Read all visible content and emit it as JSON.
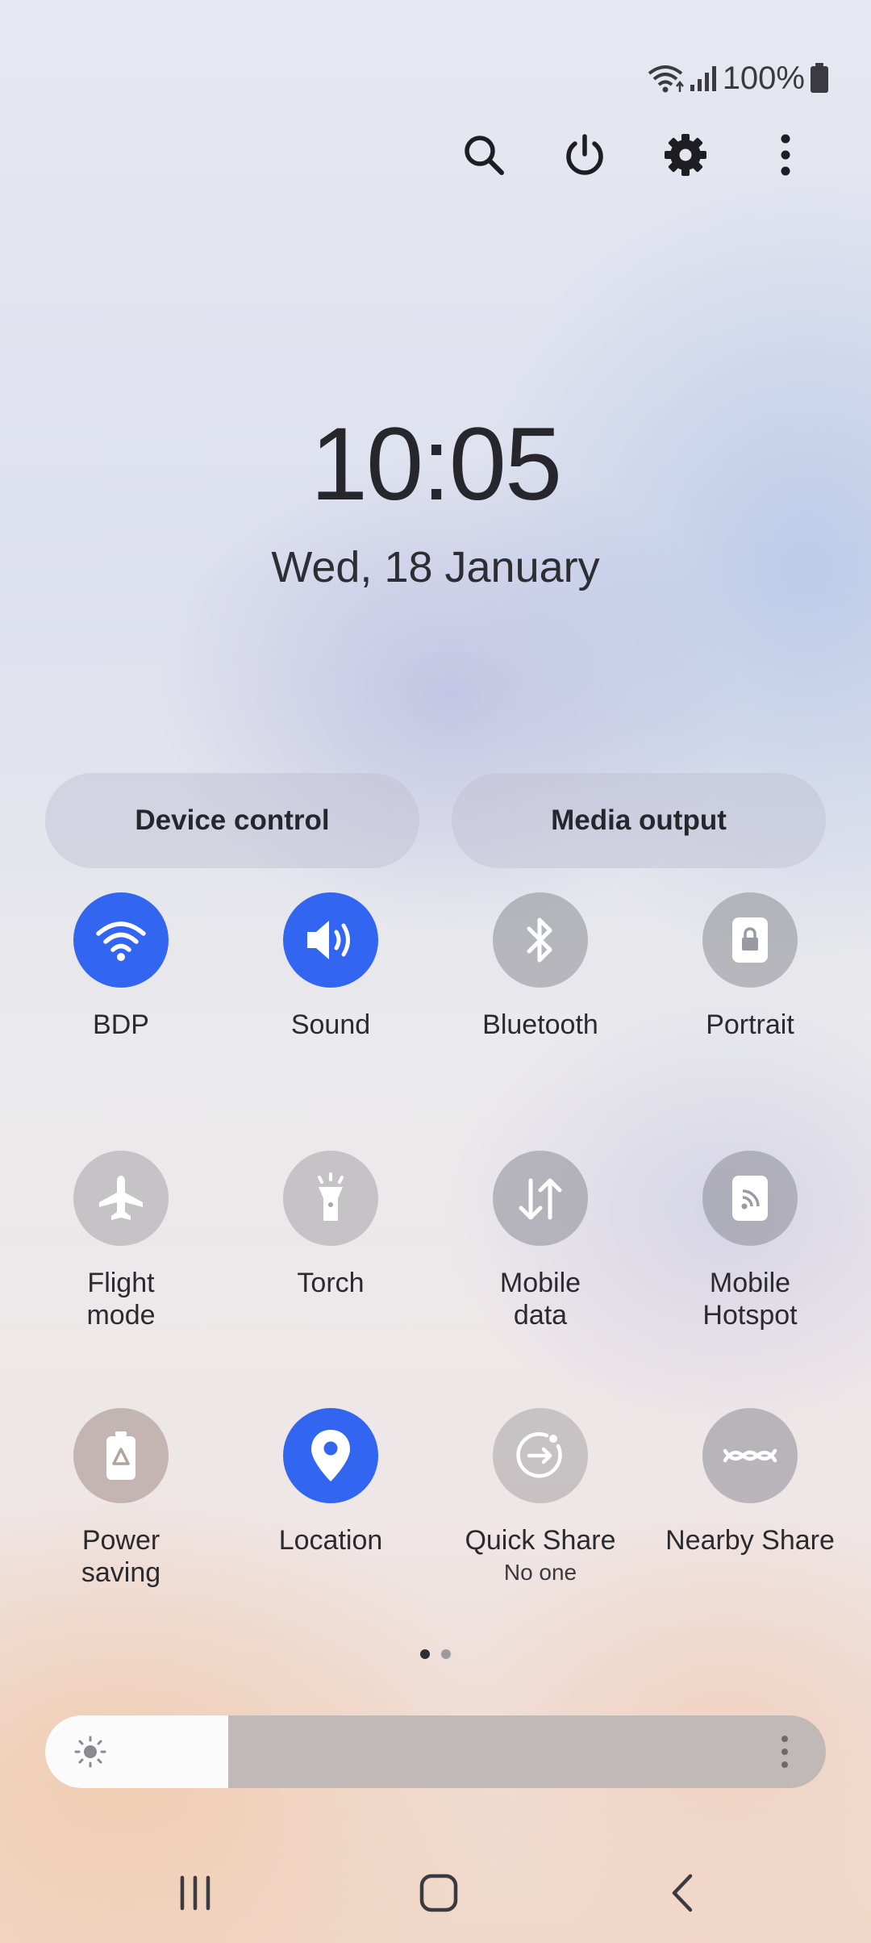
{
  "status_bar": {
    "battery_percent": "100%",
    "icons": [
      "wifi-icon",
      "signal-icon",
      "battery-icon"
    ]
  },
  "top_actions": [
    "search-icon",
    "power-icon",
    "gear-icon",
    "more-icon"
  ],
  "clock": {
    "time": "10:05",
    "date": "Wed, 18 January"
  },
  "buttons": {
    "device_control": "Device control",
    "media_output": "Media output"
  },
  "tiles": [
    {
      "label": "BDP",
      "icon": "wifi-icon",
      "state": "on"
    },
    {
      "label": "Sound",
      "icon": "sound-icon",
      "state": "on"
    },
    {
      "label": "Bluetooth",
      "icon": "bluetooth-icon",
      "state": "off"
    },
    {
      "label": "Portrait",
      "icon": "portrait-lock-icon",
      "state": "off"
    },
    {
      "label": "Flight\nmode",
      "icon": "airplane-icon",
      "state": "off"
    },
    {
      "label": "Torch",
      "icon": "torch-icon",
      "state": "off"
    },
    {
      "label": "Mobile\ndata",
      "icon": "mobile-data-icon",
      "state": "off"
    },
    {
      "label": "Mobile\nHotspot",
      "icon": "hotspot-icon",
      "state": "off"
    },
    {
      "label": "Power\nsaving",
      "icon": "power-saving-icon",
      "state": "off"
    },
    {
      "label": "Location",
      "icon": "location-icon",
      "state": "on"
    },
    {
      "label": "Quick Share",
      "sub": "No one",
      "icon": "quick-share-icon",
      "state": "off"
    },
    {
      "label": "Nearby Share",
      "icon": "nearby-share-icon",
      "state": "off"
    }
  ],
  "page_indicator": {
    "current": 1,
    "total": 2
  },
  "brightness": {
    "level": 0.235
  },
  "nav_bar": [
    "recents-icon",
    "home-icon",
    "back-icon"
  ],
  "colors": {
    "accent": "#3366f0",
    "inactive": "#8c8c96"
  }
}
